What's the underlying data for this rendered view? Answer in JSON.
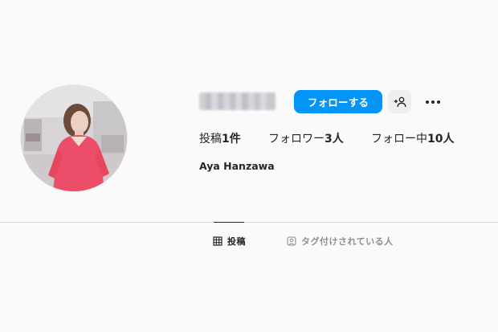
{
  "profile": {
    "username": "",
    "full_name": "Aya Hanzawa",
    "avatar": "profile-photo"
  },
  "header": {
    "follow_label": "フォローする",
    "suggest_icon": "add-user-icon",
    "more_icon": "more-horizontal-icon"
  },
  "stats": {
    "posts_label": "投稿",
    "posts_count": "1件",
    "followers_label": "フォロワー",
    "followers_count": "3人",
    "following_label": "フォロー中",
    "following_count": "10人"
  },
  "tabs": [
    {
      "label": "投稿",
      "icon": "grid-icon",
      "active": true
    },
    {
      "label": "タグ付けされている人",
      "icon": "tagged-icon",
      "active": false
    }
  ],
  "colors": {
    "accent": "#0095f6",
    "background": "#fafafa",
    "text": "#262626",
    "muted": "#8e8e8e",
    "divider": "#dbdbdb",
    "secondary_button": "#efefef"
  }
}
